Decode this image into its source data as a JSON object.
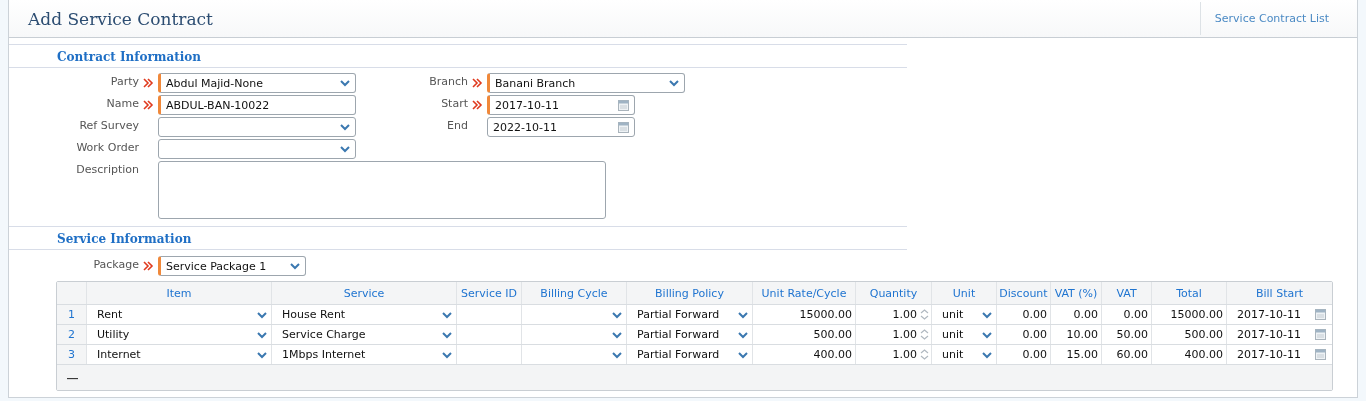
{
  "header": {
    "title": "Add Service Contract",
    "link": "Service Contract List"
  },
  "contract_information": {
    "title": "Contract Information",
    "fields_left": [
      {
        "label": "Party",
        "kind": "select",
        "value": "Abdul Majid-None",
        "required": true
      },
      {
        "label": "Name",
        "kind": "text",
        "value": "ABDUL-BAN-10022",
        "required": true
      },
      {
        "label": "Ref Survey",
        "kind": "select",
        "required": false
      },
      {
        "label": "Work Order",
        "kind": "select",
        "required": false
      }
    ],
    "fields_right": [
      {
        "label": "Branch",
        "kind": "select",
        "value": "Banani Branch",
        "required": true
      },
      {
        "label": "Start",
        "kind": "date",
        "value": "2017-10-11",
        "required": true
      },
      {
        "label": "End",
        "kind": "date",
        "value": "2022-10-11",
        "required": false
      }
    ],
    "description": {
      "label": "Description",
      "kind": "textarea",
      "required": false
    }
  },
  "service_information": {
    "title": "Service Information",
    "package": {
      "label": "Package",
      "kind": "select",
      "value": "Service Package 1",
      "required": true
    },
    "columns": [
      {
        "label": "Item",
        "kind": "select"
      },
      {
        "label": "Service",
        "kind": "select"
      },
      {
        "label": "Service ID",
        "kind": "text"
      },
      {
        "label": "Billing Cycle",
        "kind": "select"
      },
      {
        "label": "Billing Policy",
        "kind": "select"
      },
      {
        "label": "Unit Rate/Cycle",
        "kind": "number"
      },
      {
        "label": "Quantity",
        "kind": "spinner"
      },
      {
        "label": "Unit",
        "kind": "select"
      },
      {
        "label": "Discount",
        "kind": "number"
      },
      {
        "label": "VAT (%)",
        "kind": "number"
      },
      {
        "label": "VAT",
        "kind": "number"
      },
      {
        "label": "Total",
        "kind": "number"
      },
      {
        "label": "Bill Start",
        "kind": "date"
      }
    ],
    "rows": [
      {
        "number": "1",
        "cells": [
          "Rent",
          "House Rent",
          null,
          null,
          "Partial Forward",
          "15000.00",
          "1.00",
          "unit",
          "0.00",
          "0.00",
          "0.00",
          "15000.00",
          "2017-10-11"
        ]
      },
      {
        "number": "2",
        "cells": [
          "Utility",
          "Service Charge",
          null,
          null,
          "Partial Forward",
          "500.00",
          "1.00",
          "unit",
          "0.00",
          "10.00",
          "50.00",
          "500.00",
          "2017-10-11"
        ]
      },
      {
        "number": "3",
        "cells": [
          "Internet",
          "1Mbps Internet",
          null,
          null,
          "Partial Forward",
          "400.00",
          "1.00",
          "unit",
          "0.00",
          "15.00",
          "60.00",
          "400.00",
          "2017-10-11"
        ]
      }
    ],
    "remove_row_button": "—"
  }
}
